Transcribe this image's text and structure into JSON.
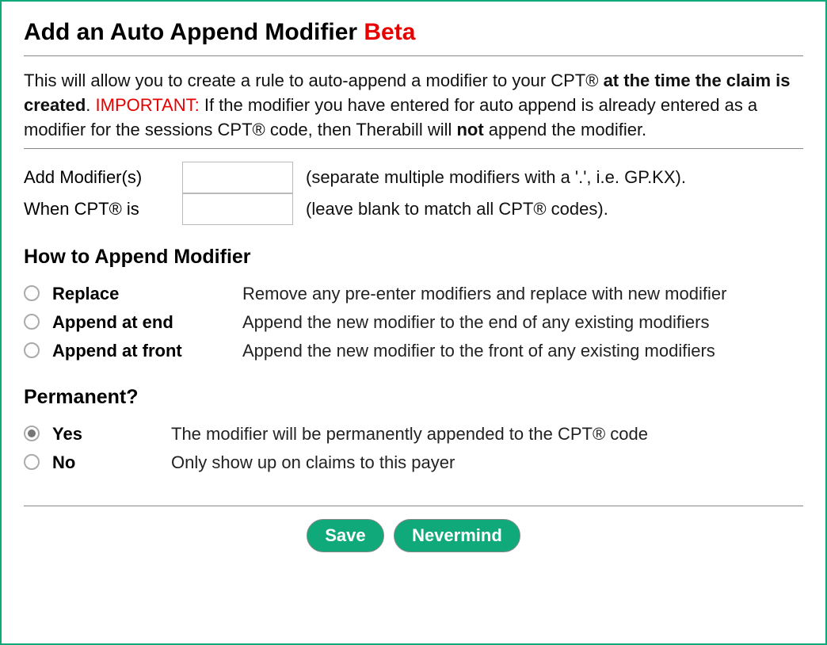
{
  "title": {
    "main": "Add an Auto Append Modifier ",
    "beta": "Beta"
  },
  "intro": {
    "p1": "This will allow you to create a rule to auto-append a modifier to your CPT® ",
    "b1": "at the time the claim is created",
    "p2": ". ",
    "imp": "IMPORTANT:",
    "p3": " If the modifier you have entered for auto append is already entered as a modifier for the sessions CPT® code, then Therabill will ",
    "b2": "not",
    "p4": " append the modifier."
  },
  "fields": {
    "addModifier": {
      "label": "Add Modifier(s)",
      "value": "",
      "hint": "(separate multiple modifiers with a '.', i.e. GP.KX)."
    },
    "whenCpt": {
      "label": "When CPT® is",
      "value": "",
      "hint": "(leave blank to match all CPT® codes)."
    }
  },
  "howSection": {
    "heading": "How to Append Modifier",
    "options": {
      "replace": {
        "name": "Replace",
        "desc": "Remove any pre-enter modifiers and replace with new modifier"
      },
      "appendEnd": {
        "name": "Append at end",
        "desc": "Append the new modifier to the end of any existing modifiers"
      },
      "appendFront": {
        "name": "Append at front",
        "desc": "Append the new modifier to the front of any existing modifiers"
      }
    }
  },
  "permSection": {
    "heading": "Permanent?",
    "options": {
      "yes": {
        "name": "Yes",
        "desc": "The modifier will be permanently appended to the CPT® code"
      },
      "no": {
        "name": "No",
        "desc": "Only show up on claims to this payer"
      }
    }
  },
  "buttons": {
    "save": "Save",
    "nevermind": "Nevermind"
  }
}
